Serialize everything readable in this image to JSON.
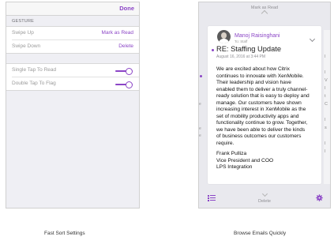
{
  "left_screen": {
    "nav": {
      "done_label": "Done"
    },
    "gesture_section": {
      "header": "GESTURE",
      "rows": [
        {
          "label": "Swipe Up",
          "value": "Mark as Read"
        },
        {
          "label": "Swipe Down",
          "value": "Delete"
        }
      ]
    },
    "tap_section": {
      "rows": [
        {
          "label": "Single Tap To Read",
          "on": true
        },
        {
          "label": "Double Tap To Flag",
          "on": true
        }
      ]
    }
  },
  "right_screen": {
    "top_hint": "Mark as Read",
    "bottom_hint": "Delete",
    "email": {
      "sender": "Manoj Raisinghani",
      "to": "To: Staff",
      "subject": "RE: Staffing Update",
      "date": "August 16, 2016 at 3:44 PM",
      "body_lines": [
        "We are excited about how Citrix",
        "continues to innovate with XenMobile.",
        "Their leadership and vision have",
        "enabled them to deliver a truly channel-",
        "ready solution that is easy to deploy and",
        "manage. Our customers have shown",
        "increasing interest in XenMobile as the",
        "set of mobility productivity apps and",
        "functionality continue to grow. Together,",
        "we have been able to deliver the kinds",
        "of business outcomes our customers",
        "require."
      ],
      "signature": [
        "Frank Pulliza",
        "Vice President and COO",
        "LPS Integration"
      ]
    },
    "edge_left_chars": [
      "e",
      "e",
      "e"
    ],
    "edge_right_chars": [
      "I",
      "I",
      "V",
      "I",
      "t",
      "C",
      "I",
      "s",
      "I",
      "I"
    ],
    "icons": {
      "list": "list-icon",
      "settings": "gear-icon"
    },
    "accent": "#8b45c6"
  },
  "captions": {
    "left": "Fast Sort Settings",
    "right": "Browse Emails Quickly"
  }
}
